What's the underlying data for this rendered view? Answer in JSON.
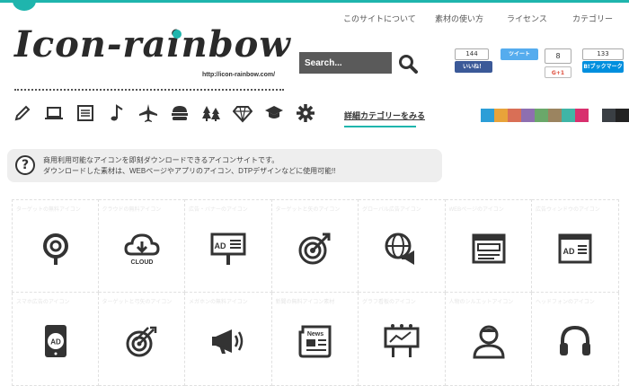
{
  "nav": {
    "about": "このサイトについて",
    "howto": "素材の使い方",
    "license": "ライセンス",
    "category": "カテゴリー"
  },
  "logo": {
    "text": "Icon-rainbow",
    "url": "http://icon-rainbow.com/"
  },
  "search": {
    "placeholder": "Search..."
  },
  "share": {
    "facebook_count": "144",
    "facebook_label": "いいね！",
    "twitter_label": "ツイート",
    "gplus_count": "8",
    "gplus_label": "G+1",
    "hatena_count": "133",
    "hatena_label": "B!ブックマーク"
  },
  "categories": {
    "items": [
      "pencil-icon",
      "laptop-icon",
      "newspaper-icon",
      "music-note-icon",
      "airplane-icon",
      "hamburger-icon",
      "trees-icon",
      "diamond-icon",
      "graduation-cap-icon",
      "gear-icon"
    ],
    "detail_link": "詳細カテゴリーをみる"
  },
  "swatches": [
    "#2c9ed7",
    "#e8a33a",
    "#d96f56",
    "#8e6fb0",
    "#6aa86a",
    "#9b8460",
    "#3fb5a6",
    "#d8306e",
    "#ffffff",
    "#3a3f44",
    "#222222"
  ],
  "info": {
    "line1": "商用利用可能なアイコンを即刻ダウンロードできるアイコンサイトです。",
    "line2": "ダウンロードした素材は、WEBページやアプリのアイコン、DTPデザインなどに使用可能!!"
  },
  "colors": {
    "accent": "#1fb5ad",
    "icon": "#333333"
  },
  "grid": [
    {
      "icon": "target-map-icon",
      "caption": "ターゲットの無料アイコン"
    },
    {
      "icon": "cloud-download-icon",
      "caption": "クラウドの無料アイコン",
      "label": "CLOUD"
    },
    {
      "icon": "ad-billboard-icon",
      "caption": "広告・バナーのアイコン",
      "label": "AD"
    },
    {
      "icon": "target-arrow-icon",
      "caption": "ターゲットと矢のアイコン"
    },
    {
      "icon": "globe-megaphone-icon",
      "caption": "グローバル広告アイコン"
    },
    {
      "icon": "web-window-icon",
      "caption": "WEBページのアイコン"
    },
    {
      "icon": "ad-window-icon",
      "caption": "広告ウィンドウのアイコン",
      "label": "AD"
    },
    {
      "icon": "smartphone-ad-icon",
      "caption": "スマホ広告のアイコン",
      "label": "AD"
    },
    {
      "icon": "target-arrows-icon",
      "caption": "ターゲットと弓矢のアイコン"
    },
    {
      "icon": "megaphone-icon",
      "caption": "メガホンの無料アイコン"
    },
    {
      "icon": "newspaper-news-icon",
      "caption": "新聞の無料アイコン素材",
      "label": "News"
    },
    {
      "icon": "chart-billboard-icon",
      "caption": "グラフ看板のアイコン"
    },
    {
      "icon": "person-icon",
      "caption": "人物のシルエットアイコン"
    },
    {
      "icon": "headphones-icon",
      "caption": "ヘッドフォンのアイコン"
    }
  ]
}
